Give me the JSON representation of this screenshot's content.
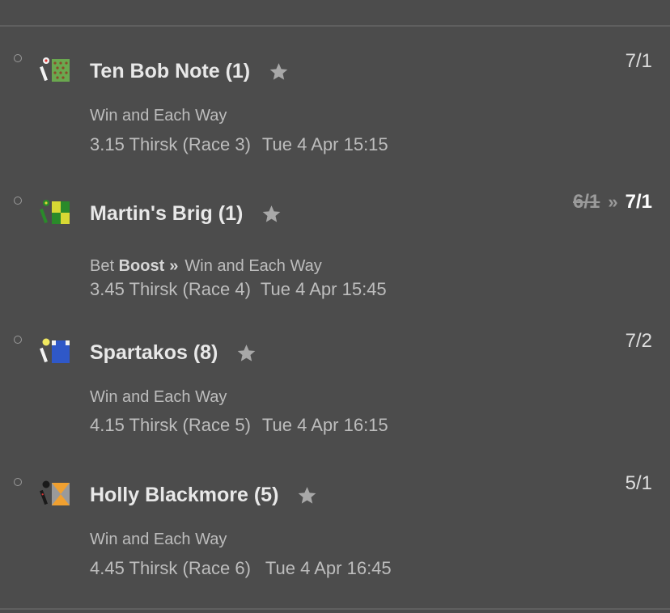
{
  "bets": [
    {
      "name": "Ten Bob Note (1)",
      "odds": "7/1",
      "market": "Win and Each Way",
      "race": "3.15 Thirsk (Race 3)",
      "date": "Tue 4 Apr 15:15",
      "silk": "green-brown-spots-silk",
      "boosted": false
    },
    {
      "name": "Martin's Brig (1)",
      "odds_old": "6/1",
      "odds": "7/1",
      "market_prefix": "Bet",
      "market_boost": "Boost",
      "market": "Win and Each Way",
      "race": "3.45 Thirsk (Race 4)",
      "date": "Tue 4 Apr 15:45",
      "silk": "green-yellow-check-silk",
      "boosted": true
    },
    {
      "name": "Spartakos (8)",
      "odds": "7/2",
      "market": "Win and Each Way",
      "race": "4.15 Thirsk (Race 5)",
      "date": "Tue 4 Apr 16:15",
      "silk": "blue-yellow-silk",
      "boosted": false
    },
    {
      "name": "Holly Blackmore (5)",
      "odds": "5/1",
      "market": "Win and Each Way",
      "race": "4.45 Thirsk (Race 6)",
      "date": "Tue 4 Apr 16:45",
      "silk": "orange-grey-black-silk",
      "boosted": false
    }
  ],
  "colors": {
    "background": "#4c4c4c",
    "name": "#e8e8e8",
    "secondary": "#bdbdbd",
    "star": "#a8a8a8"
  }
}
